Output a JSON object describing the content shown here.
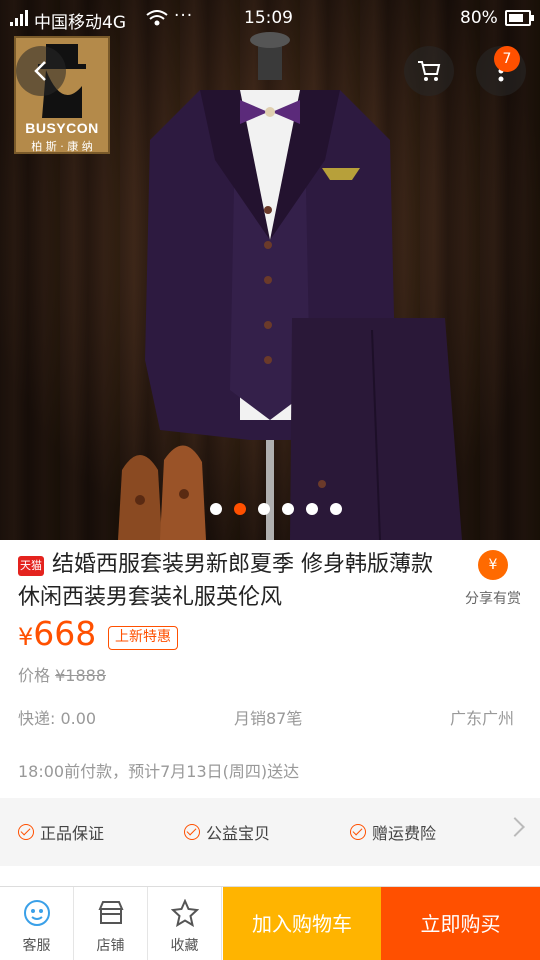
{
  "status_bar": {
    "carrier": "中国移动4G",
    "time": "15:09",
    "battery": "80%",
    "battery_level": 0.8,
    "more_indicator": "···"
  },
  "header": {
    "back_icon": "chevron-left-icon",
    "cart_icon": "cart-icon",
    "more_icon": "more-vertical-icon",
    "badge_count": "7"
  },
  "hero": {
    "logo_text": "BUSYCON",
    "logo_text_cn": "柏 斯 · 康 纳",
    "image_count": 6,
    "active_index": 1
  },
  "product": {
    "tmall_tag": "天猫",
    "title": "结婚西服套装男新郎夏季 修身韩版薄款休闲西装男套装礼服英伦风",
    "price_symbol": "¥",
    "price": "668",
    "promo_tag": "上新特惠",
    "orig_price_label": "价格",
    "orig_price": "¥1888",
    "shipping": "快递: 0.00",
    "monthly_sales": "月销87笔",
    "location": "广东广州",
    "delivery_note": "18:00前付款，预计7月13日(周四)送达"
  },
  "share": {
    "label": "分享有赏",
    "icon": "¥"
  },
  "guarantees": [
    "正品保证",
    "公益宝贝",
    "赠运费险"
  ],
  "bottom_bar": {
    "service": "客服",
    "store": "店铺",
    "favorite": "收藏",
    "add_to_cart": "加入购物车",
    "buy_now": "立即购买"
  },
  "colors": {
    "accent": "#ff5000",
    "cart_button": "#ffb400",
    "tmall_red": "#e4231e"
  }
}
